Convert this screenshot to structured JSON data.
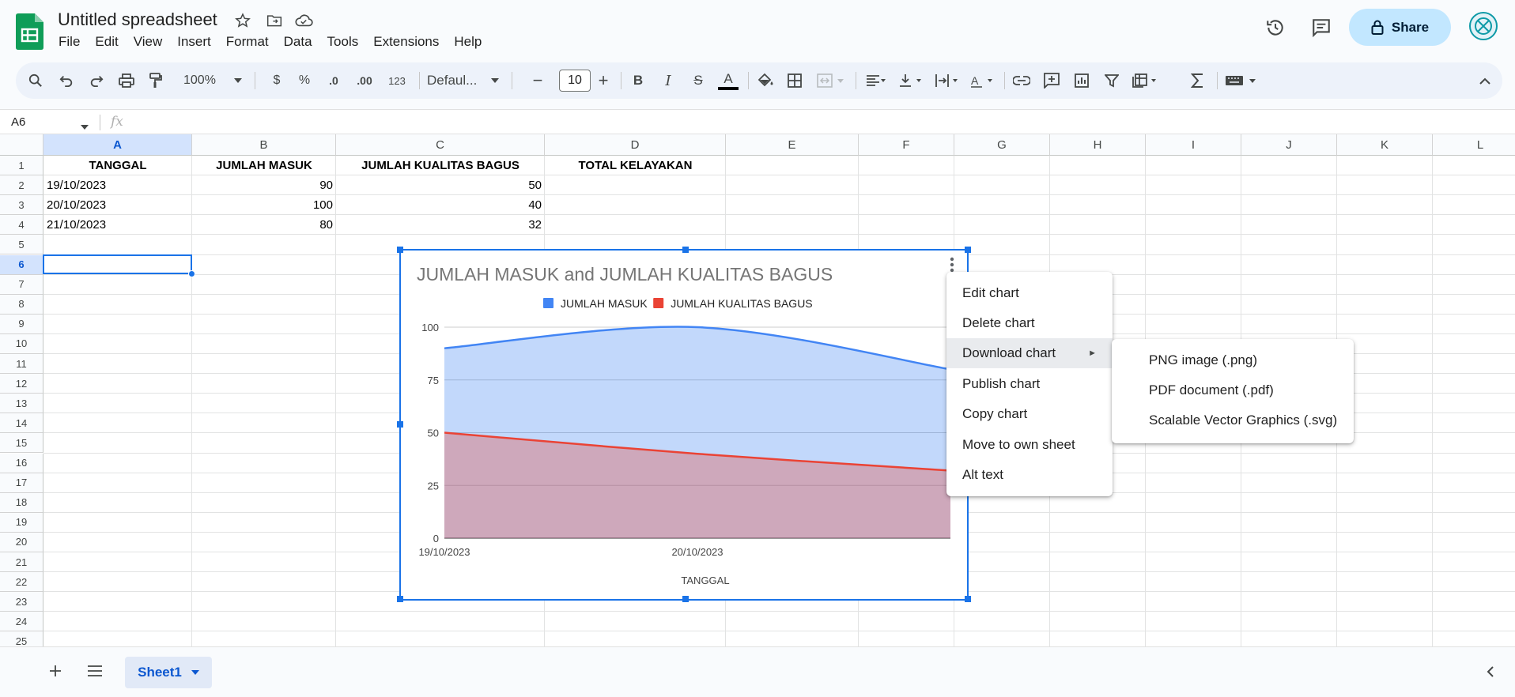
{
  "app": {
    "doc_title": "Untitled spreadsheet",
    "menu": [
      "File",
      "Edit",
      "View",
      "Insert",
      "Format",
      "Data",
      "Tools",
      "Extensions",
      "Help"
    ],
    "share_label": "Share"
  },
  "toolbar": {
    "zoom": "100%",
    "currency": "$",
    "percent": "%",
    "dec_decrease": ".0",
    "dec_increase": ".00",
    "number_format": "123",
    "font": "Defaul...",
    "font_size": "10",
    "minus": "−",
    "plus": "+",
    "bold": "B",
    "italic": "I",
    "strike": "S",
    "text_color": "A"
  },
  "formula_bar": {
    "name_box": "A6",
    "fx": "fx",
    "value": ""
  },
  "grid": {
    "columns": [
      "A",
      "B",
      "C",
      "D",
      "E",
      "F",
      "G",
      "H",
      "I",
      "J",
      "K",
      "L"
    ],
    "rows": [
      "1",
      "2",
      "3",
      "4",
      "5",
      "6",
      "7",
      "8",
      "9",
      "10",
      "11",
      "12",
      "13",
      "14",
      "15",
      "16",
      "17",
      "18",
      "19",
      "20",
      "21",
      "22",
      "23",
      "24",
      "25"
    ],
    "headers": [
      "TANGGAL",
      "JUMLAH MASUK",
      "JUMLAH KUALITAS BAGUS",
      "TOTAL KELAYAKAN"
    ],
    "data": [
      [
        "19/10/2023",
        "90",
        "50"
      ],
      [
        "20/10/2023",
        "100",
        "40"
      ],
      [
        "21/10/2023",
        "80",
        "32"
      ]
    ]
  },
  "chart_data": {
    "type": "area",
    "title": "JUMLAH MASUK and JUMLAH KUALITAS BAGUS",
    "xlabel": "TANGGAL",
    "ylabel": "",
    "categories": [
      "19/10/2023",
      "20/10/2023",
      "21/10/2023"
    ],
    "x_tick_labels": [
      "19/10/2023",
      "20/10/2023"
    ],
    "y_ticks": [
      "0",
      "25",
      "50",
      "75",
      "100"
    ],
    "ylim": [
      0,
      100
    ],
    "grid": true,
    "legend": "top",
    "series": [
      {
        "name": "JUMLAH MASUK",
        "values": [
          90,
          100,
          80
        ],
        "color": "#4285f4"
      },
      {
        "name": "JUMLAH KUALITAS BAGUS",
        "values": [
          50,
          40,
          32
        ],
        "color": "#ea4335"
      }
    ]
  },
  "context_menu": {
    "items": [
      "Edit chart",
      "Delete chart",
      "Download chart",
      "Publish chart",
      "Copy chart",
      "Move to own sheet",
      "Alt text"
    ],
    "submenu_arrow": "►"
  },
  "download_submenu": {
    "items": [
      "PNG image (.png)",
      "PDF document (.pdf)",
      "Scalable Vector Graphics (.svg)"
    ]
  },
  "sheets": {
    "active": "Sheet1"
  },
  "colors": {
    "accent": "#1a73e8",
    "share_bg": "#c2e7ff",
    "logo_green": "#0f9d58"
  }
}
